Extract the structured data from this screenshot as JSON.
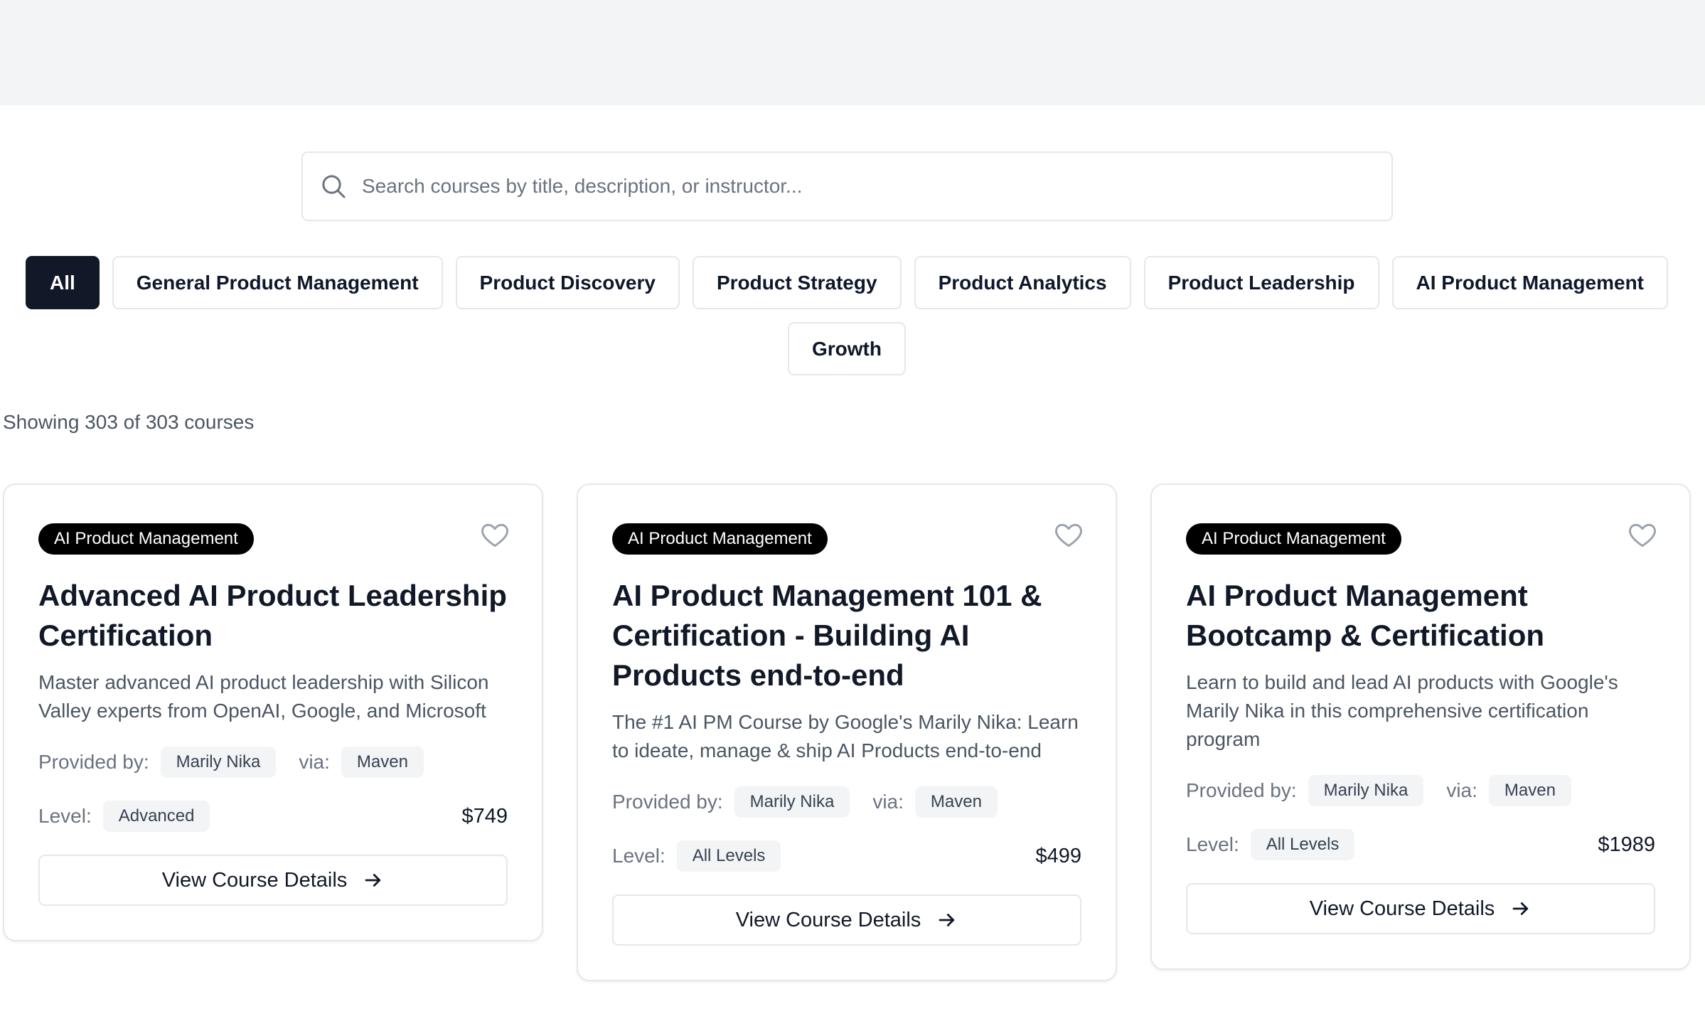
{
  "search": {
    "placeholder": "Search courses by title, description, or instructor...",
    "value": ""
  },
  "filters": [
    {
      "label": "All",
      "active": true
    },
    {
      "label": "General Product Management"
    },
    {
      "label": "Product Discovery"
    },
    {
      "label": "Product Strategy"
    },
    {
      "label": "Product Analytics"
    },
    {
      "label": "Product Leadership"
    },
    {
      "label": "AI Product Management"
    },
    {
      "label": "Growth"
    }
  ],
  "results": {
    "showing_text": "Showing 303 of 303 courses"
  },
  "courses": [
    {
      "category": "AI Product Management",
      "title": "Advanced AI Product Leadership Certification",
      "description": "Master advanced AI product leadership with Silicon Valley experts from OpenAI, Google, and Microsoft",
      "provided_by_label": "Provided by:",
      "instructor": "Marily Nika",
      "via_label": "via:",
      "platform": "Maven",
      "level_label": "Level:",
      "level": "Advanced",
      "price": "$749",
      "button_label": "View Course Details"
    },
    {
      "category": "AI Product Management",
      "title": "AI Product Management 101 & Certification - Building AI Products end-to-end",
      "description": "The #1 AI PM Course by Google's Marily Nika: Learn to ideate, manage & ship AI Products end-to-end",
      "provided_by_label": "Provided by:",
      "instructor": "Marily Nika",
      "via_label": "via:",
      "platform": "Maven",
      "level_label": "Level:",
      "level": "All Levels",
      "price": "$499",
      "button_label": "View Course Details"
    },
    {
      "category": "AI Product Management",
      "title": "AI Product Management Bootcamp & Certification",
      "description": "Learn to build and lead AI products with Google's Marily Nika in this comprehensive certification program",
      "provided_by_label": "Provided by:",
      "instructor": "Marily Nika",
      "via_label": "via:",
      "platform": "Maven",
      "level_label": "Level:",
      "level": "All Levels",
      "price": "$1989",
      "button_label": "View Course Details"
    }
  ],
  "icons": {
    "search": "search-icon",
    "favorite": "heart-icon",
    "arrow": "arrow-right-icon"
  },
  "colors": {
    "accent": "#111827",
    "badge": "#000000",
    "pill": "#f3f4f6",
    "background_band": "#f3f4f6"
  }
}
